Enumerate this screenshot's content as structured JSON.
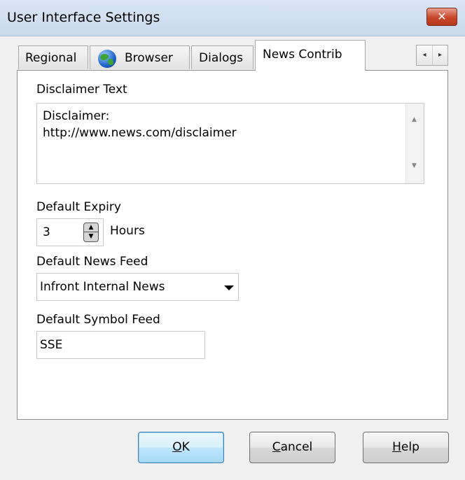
{
  "window": {
    "title": "User Interface Settings",
    "close_glyph": "✕"
  },
  "tabs": [
    {
      "label": "Regional",
      "active": false
    },
    {
      "label": "Browser",
      "active": false,
      "icon": "globe-icon"
    },
    {
      "label": "Dialogs",
      "active": false
    },
    {
      "label": "News Contrib",
      "active": true
    }
  ],
  "tab_scroll": {
    "left_glyph": "◂",
    "right_glyph": "▸"
  },
  "news_contrib": {
    "disclaimer_label": "Disclaimer Text",
    "disclaimer_lines": [
      "Disclaimer:",
      "http://www.news.com/disclaimer"
    ],
    "expiry_label": "Default Expiry",
    "expiry_value": "3",
    "expiry_unit": "Hours",
    "news_feed_label": "Default News Feed",
    "news_feed_value": "Infront Internal News",
    "symbol_feed_label": "Default Symbol Feed",
    "symbol_feed_value": "SSE"
  },
  "buttons": {
    "ok": {
      "mnemonic": "O",
      "rest": "K"
    },
    "cancel": {
      "mnemonic": "C",
      "rest": "ancel"
    },
    "help": {
      "mnemonic": "H",
      "rest": "elp"
    }
  },
  "colors": {
    "title_bar": "#c7d8ee",
    "close_button": "#c8462a",
    "default_button": "#bee6fd"
  }
}
